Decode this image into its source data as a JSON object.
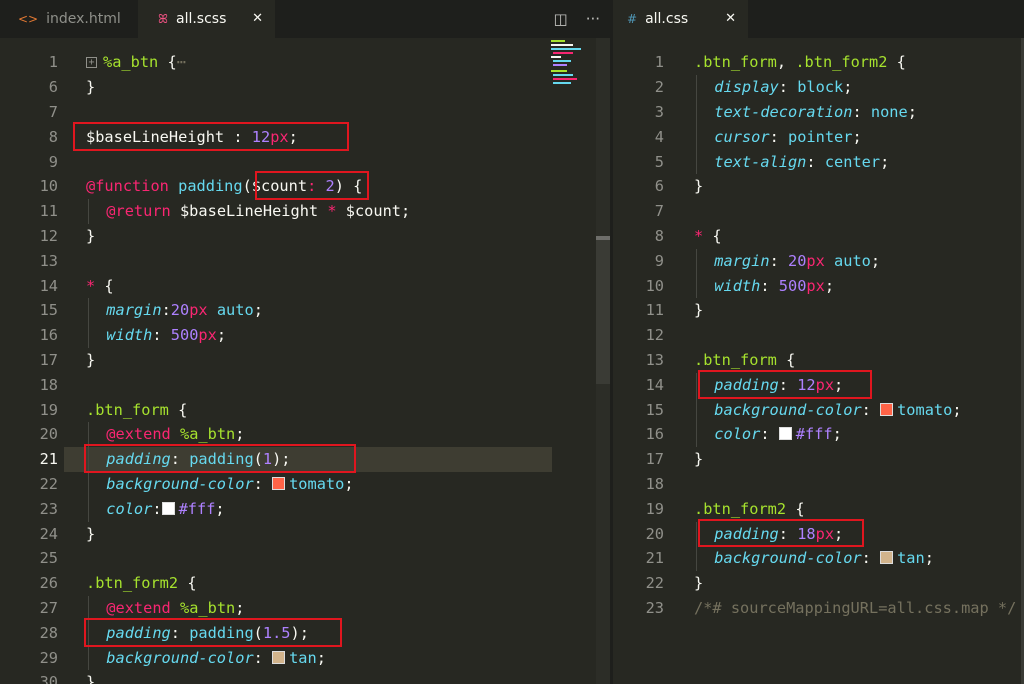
{
  "left": {
    "tabs": [
      {
        "icon": "<>",
        "label": "index.html",
        "active": false
      },
      {
        "icon": "ꕤ",
        "label": "all.scss",
        "active": true,
        "close": "✕"
      }
    ],
    "actions": {
      "split": "◫",
      "more": "···"
    },
    "lines": [
      {
        "n": "1",
        "indent": 0,
        "tokens": [
          [
            "fold",
            "+"
          ],
          [
            "sel",
            "%a_btn"
          ],
          [
            "var",
            " {"
          ],
          [
            "com",
            "⋯"
          ]
        ]
      },
      {
        "n": "6",
        "indent": 0,
        "tokens": [
          [
            "var",
            "}"
          ]
        ]
      },
      {
        "n": "7",
        "indent": 0,
        "tokens": []
      },
      {
        "n": "8",
        "indent": 0,
        "tokens": [
          [
            "var",
            "$baseLineHeight"
          ],
          [
            "var",
            " : "
          ],
          [
            "num",
            "12"
          ],
          [
            "unit",
            "px"
          ],
          [
            "var",
            ";"
          ]
        ]
      },
      {
        "n": "9",
        "indent": 0,
        "tokens": []
      },
      {
        "n": "10",
        "indent": 0,
        "tokens": [
          [
            "kw",
            "@function"
          ],
          [
            "var",
            " "
          ],
          [
            "fn",
            "padding"
          ],
          [
            "var",
            "("
          ],
          [
            "var",
            "$count"
          ],
          [
            "op",
            ":"
          ],
          [
            "var",
            " "
          ],
          [
            "num",
            "2"
          ],
          [
            "var",
            ") {"
          ]
        ]
      },
      {
        "n": "11",
        "indent": 1,
        "tokens": [
          [
            "kw",
            "@return"
          ],
          [
            "var",
            " $baseLineHeight "
          ],
          [
            "op",
            "*"
          ],
          [
            "var",
            " $count;"
          ]
        ]
      },
      {
        "n": "12",
        "indent": 0,
        "tokens": [
          [
            "var",
            "}"
          ]
        ]
      },
      {
        "n": "13",
        "indent": 0,
        "tokens": []
      },
      {
        "n": "14",
        "indent": 0,
        "tokens": [
          [
            "kw",
            "*"
          ],
          [
            "var",
            " {"
          ]
        ]
      },
      {
        "n": "15",
        "indent": 1,
        "tokens": [
          [
            "prop",
            "margin"
          ],
          [
            "var",
            ":"
          ],
          [
            "num",
            "20"
          ],
          [
            "unit",
            "px"
          ],
          [
            "var",
            " "
          ],
          [
            "fn",
            "auto"
          ],
          [
            "var",
            ";"
          ]
        ]
      },
      {
        "n": "16",
        "indent": 1,
        "tokens": [
          [
            "prop",
            "width"
          ],
          [
            "var",
            ": "
          ],
          [
            "num",
            "500"
          ],
          [
            "unit",
            "px"
          ],
          [
            "var",
            ";"
          ]
        ]
      },
      {
        "n": "17",
        "indent": 0,
        "tokens": [
          [
            "var",
            "}"
          ]
        ]
      },
      {
        "n": "18",
        "indent": 0,
        "tokens": []
      },
      {
        "n": "19",
        "indent": 0,
        "tokens": [
          [
            "sel",
            ".btn_form"
          ],
          [
            "var",
            " {"
          ]
        ]
      },
      {
        "n": "20",
        "indent": 1,
        "tokens": [
          [
            "kw",
            "@extend"
          ],
          [
            "var",
            " "
          ],
          [
            "sel",
            "%a_btn"
          ],
          [
            "var",
            ";"
          ]
        ]
      },
      {
        "n": "21",
        "indent": 1,
        "tokens": [
          [
            "prop",
            "padding"
          ],
          [
            "var",
            ": "
          ],
          [
            "fn",
            "padding"
          ],
          [
            "var",
            "("
          ],
          [
            "num",
            "1"
          ],
          [
            "var",
            ");"
          ]
        ],
        "current": true
      },
      {
        "n": "22",
        "indent": 1,
        "tokens": [
          [
            "prop",
            "background-color"
          ],
          [
            "var",
            ": "
          ],
          [
            "swatch",
            "#ff6347"
          ],
          [
            "fn",
            "tomato"
          ],
          [
            "var",
            ";"
          ]
        ]
      },
      {
        "n": "23",
        "indent": 1,
        "tokens": [
          [
            "prop",
            "color"
          ],
          [
            "var",
            ":"
          ],
          [
            "swatch",
            "#ffffff"
          ],
          [
            "num",
            "#fff"
          ],
          [
            "var",
            ";"
          ]
        ]
      },
      {
        "n": "24",
        "indent": 0,
        "tokens": [
          [
            "var",
            "}"
          ]
        ]
      },
      {
        "n": "25",
        "indent": 0,
        "tokens": []
      },
      {
        "n": "26",
        "indent": 0,
        "tokens": [
          [
            "sel",
            ".btn_form2"
          ],
          [
            "var",
            " {"
          ]
        ]
      },
      {
        "n": "27",
        "indent": 1,
        "tokens": [
          [
            "kw",
            "@extend"
          ],
          [
            "var",
            " "
          ],
          [
            "sel",
            "%a_btn"
          ],
          [
            "var",
            ";"
          ]
        ]
      },
      {
        "n": "28",
        "indent": 1,
        "tokens": [
          [
            "prop",
            "padding"
          ],
          [
            "var",
            ": "
          ],
          [
            "fn",
            "padding"
          ],
          [
            "var",
            "("
          ],
          [
            "num",
            "1.5"
          ],
          [
            "var",
            ");"
          ]
        ]
      },
      {
        "n": "29",
        "indent": 1,
        "tokens": [
          [
            "prop",
            "background-color"
          ],
          [
            "var",
            ": "
          ],
          [
            "swatch",
            "#d2b48c"
          ],
          [
            "fn",
            "tan"
          ],
          [
            "var",
            ";"
          ]
        ]
      },
      {
        "n": "30",
        "indent": 0,
        "tokens": [
          [
            "var",
            "}"
          ]
        ]
      }
    ]
  },
  "right": {
    "tabs": [
      {
        "icon": "#",
        "label": "all.css",
        "active": true,
        "close": "✕"
      }
    ],
    "lines": [
      {
        "n": "1",
        "indent": 0,
        "tokens": [
          [
            "sel",
            ".btn_form"
          ],
          [
            "var",
            ", "
          ],
          [
            "sel",
            ".btn_form2"
          ],
          [
            "var",
            " {"
          ]
        ]
      },
      {
        "n": "2",
        "indent": 1,
        "tokens": [
          [
            "prop",
            "display"
          ],
          [
            "var",
            ": "
          ],
          [
            "fn",
            "block"
          ],
          [
            "var",
            ";"
          ]
        ]
      },
      {
        "n": "3",
        "indent": 1,
        "tokens": [
          [
            "prop",
            "text-decoration"
          ],
          [
            "var",
            ": "
          ],
          [
            "fn",
            "none"
          ],
          [
            "var",
            ";"
          ]
        ]
      },
      {
        "n": "4",
        "indent": 1,
        "tokens": [
          [
            "prop",
            "cursor"
          ],
          [
            "var",
            ": "
          ],
          [
            "fn",
            "pointer"
          ],
          [
            "var",
            ";"
          ]
        ]
      },
      {
        "n": "5",
        "indent": 1,
        "tokens": [
          [
            "prop",
            "text-align"
          ],
          [
            "var",
            ": "
          ],
          [
            "fn",
            "center"
          ],
          [
            "var",
            ";"
          ]
        ]
      },
      {
        "n": "6",
        "indent": 0,
        "tokens": [
          [
            "var",
            "}"
          ]
        ]
      },
      {
        "n": "7",
        "indent": 0,
        "tokens": []
      },
      {
        "n": "8",
        "indent": 0,
        "tokens": [
          [
            "kw",
            "*"
          ],
          [
            "var",
            " {"
          ]
        ]
      },
      {
        "n": "9",
        "indent": 1,
        "tokens": [
          [
            "prop",
            "margin"
          ],
          [
            "var",
            ": "
          ],
          [
            "num",
            "20"
          ],
          [
            "unit",
            "px"
          ],
          [
            "var",
            " "
          ],
          [
            "fn",
            "auto"
          ],
          [
            "var",
            ";"
          ]
        ]
      },
      {
        "n": "10",
        "indent": 1,
        "tokens": [
          [
            "prop",
            "width"
          ],
          [
            "var",
            ": "
          ],
          [
            "num",
            "500"
          ],
          [
            "unit",
            "px"
          ],
          [
            "var",
            ";"
          ]
        ]
      },
      {
        "n": "11",
        "indent": 0,
        "tokens": [
          [
            "var",
            "}"
          ]
        ]
      },
      {
        "n": "12",
        "indent": 0,
        "tokens": []
      },
      {
        "n": "13",
        "indent": 0,
        "tokens": [
          [
            "sel",
            ".btn_form"
          ],
          [
            "var",
            " {"
          ]
        ]
      },
      {
        "n": "14",
        "indent": 1,
        "tokens": [
          [
            "prop",
            "padding"
          ],
          [
            "var",
            ": "
          ],
          [
            "num",
            "12"
          ],
          [
            "unit",
            "px"
          ],
          [
            "var",
            ";"
          ]
        ]
      },
      {
        "n": "15",
        "indent": 1,
        "tokens": [
          [
            "prop",
            "background-color"
          ],
          [
            "var",
            ": "
          ],
          [
            "swatch",
            "#ff6347"
          ],
          [
            "fn",
            "tomato"
          ],
          [
            "var",
            ";"
          ]
        ]
      },
      {
        "n": "16",
        "indent": 1,
        "tokens": [
          [
            "prop",
            "color"
          ],
          [
            "var",
            ": "
          ],
          [
            "swatch",
            "#ffffff"
          ],
          [
            "num",
            "#fff"
          ],
          [
            "var",
            ";"
          ]
        ]
      },
      {
        "n": "17",
        "indent": 0,
        "tokens": [
          [
            "var",
            "}"
          ]
        ]
      },
      {
        "n": "18",
        "indent": 0,
        "tokens": []
      },
      {
        "n": "19",
        "indent": 0,
        "tokens": [
          [
            "sel",
            ".btn_form2"
          ],
          [
            "var",
            " {"
          ]
        ]
      },
      {
        "n": "20",
        "indent": 1,
        "tokens": [
          [
            "prop",
            "padding"
          ],
          [
            "var",
            ": "
          ],
          [
            "num",
            "18"
          ],
          [
            "unit",
            "px"
          ],
          [
            "var",
            ";"
          ]
        ]
      },
      {
        "n": "21",
        "indent": 1,
        "tokens": [
          [
            "prop",
            "background-color"
          ],
          [
            "var",
            ": "
          ],
          [
            "swatch",
            "#d2b48c"
          ],
          [
            "fn",
            "tan"
          ],
          [
            "var",
            ";"
          ]
        ]
      },
      {
        "n": "22",
        "indent": 0,
        "tokens": [
          [
            "var",
            "}"
          ]
        ]
      },
      {
        "n": "23",
        "indent": 0,
        "tokens": [
          [
            "com",
            "/*# sourceMappingURL=all.css.map */"
          ]
        ]
      }
    ]
  }
}
